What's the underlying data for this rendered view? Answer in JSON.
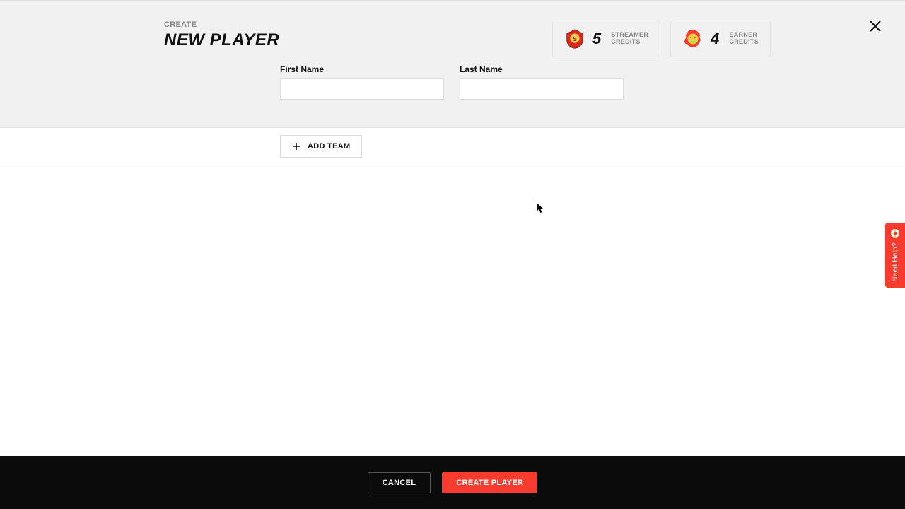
{
  "header": {
    "eyebrow": "CREATE",
    "title": "NEW PLAYER"
  },
  "credits": {
    "streamer": {
      "count": "5",
      "label1": "STREAMER",
      "label2": "CREDITS"
    },
    "earner": {
      "count": "4",
      "label1": "EARNER",
      "label2": "CREDITS"
    }
  },
  "form": {
    "first_name_label": "First Name",
    "first_name_value": "",
    "last_name_label": "Last Name",
    "last_name_value": ""
  },
  "add_team_label": "ADD TEAM",
  "help_label": "Need Help?",
  "footer": {
    "cancel": "CANCEL",
    "create": "CREATE PLAYER"
  }
}
